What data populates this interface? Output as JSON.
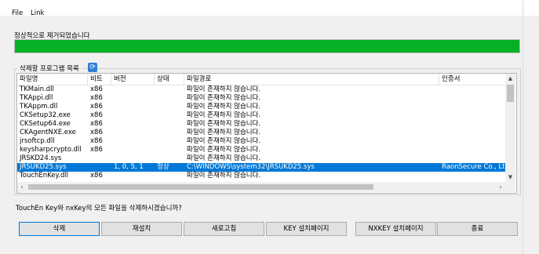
{
  "menu": {
    "file": "File",
    "link": "Link"
  },
  "status": {
    "text": "정상적으로 제거되었습니다",
    "progress": 1.0,
    "progress_color": "#06b025"
  },
  "group": {
    "label": "삭제할 프로그램 목록",
    "refresh_icon": "refresh-icon"
  },
  "table": {
    "headers": [
      "파일명",
      "비트",
      "버전",
      "상태",
      "파일경로",
      "인증서"
    ],
    "rows": [
      [
        "TKMain.dll",
        "x86",
        "",
        "",
        "파일이 존재하지 않습니다.",
        ""
      ],
      [
        "TKAppi.dll",
        "x86",
        "",
        "",
        "파일이 존재하지 않습니다.",
        ""
      ],
      [
        "TKAppm.dll",
        "x86",
        "",
        "",
        "파일이 존재하지 않습니다.",
        ""
      ],
      [
        "CKSetup32.exe",
        "x86",
        "",
        "",
        "파일이 존재하지 않습니다.",
        ""
      ],
      [
        "CKSetup64.exe",
        "x86",
        "",
        "",
        "파일이 존재하지 않습니다.",
        ""
      ],
      [
        "CKAgentNXE.exe",
        "x86",
        "",
        "",
        "파일이 존재하지 않습니다.",
        ""
      ],
      [
        "jrsoftcp.dll",
        "x86",
        "",
        "",
        "파일이 존재하지 않습니다.",
        ""
      ],
      [
        "keysharpcrypto.dll",
        "x86",
        "",
        "",
        "파일이 존재하지 않습니다.",
        ""
      ],
      [
        "JRSKD24.sys",
        "",
        "",
        "",
        "파일이 존재하지 않습니다.",
        ""
      ],
      [
        "JRSUKD25.sys",
        "",
        "1, 0, 5, 1",
        "정상",
        "C:\\WINDOWS\\system32\\JRSUKD25.sys",
        "RaonSecure Co., Lt"
      ],
      [
        "TouchEnKey.dll",
        "x86",
        "",
        "",
        "파일이 존재하지 않습니다.",
        ""
      ]
    ],
    "selected_index": 9
  },
  "question": "TouchEn Key와 nxKey의 모든 파일을 삭제하시겠습니까?",
  "buttons": [
    "삭제",
    "재설치",
    "새로고침",
    "KEY 설치페이지",
    "NXKEY 설치페이지",
    "종료"
  ]
}
